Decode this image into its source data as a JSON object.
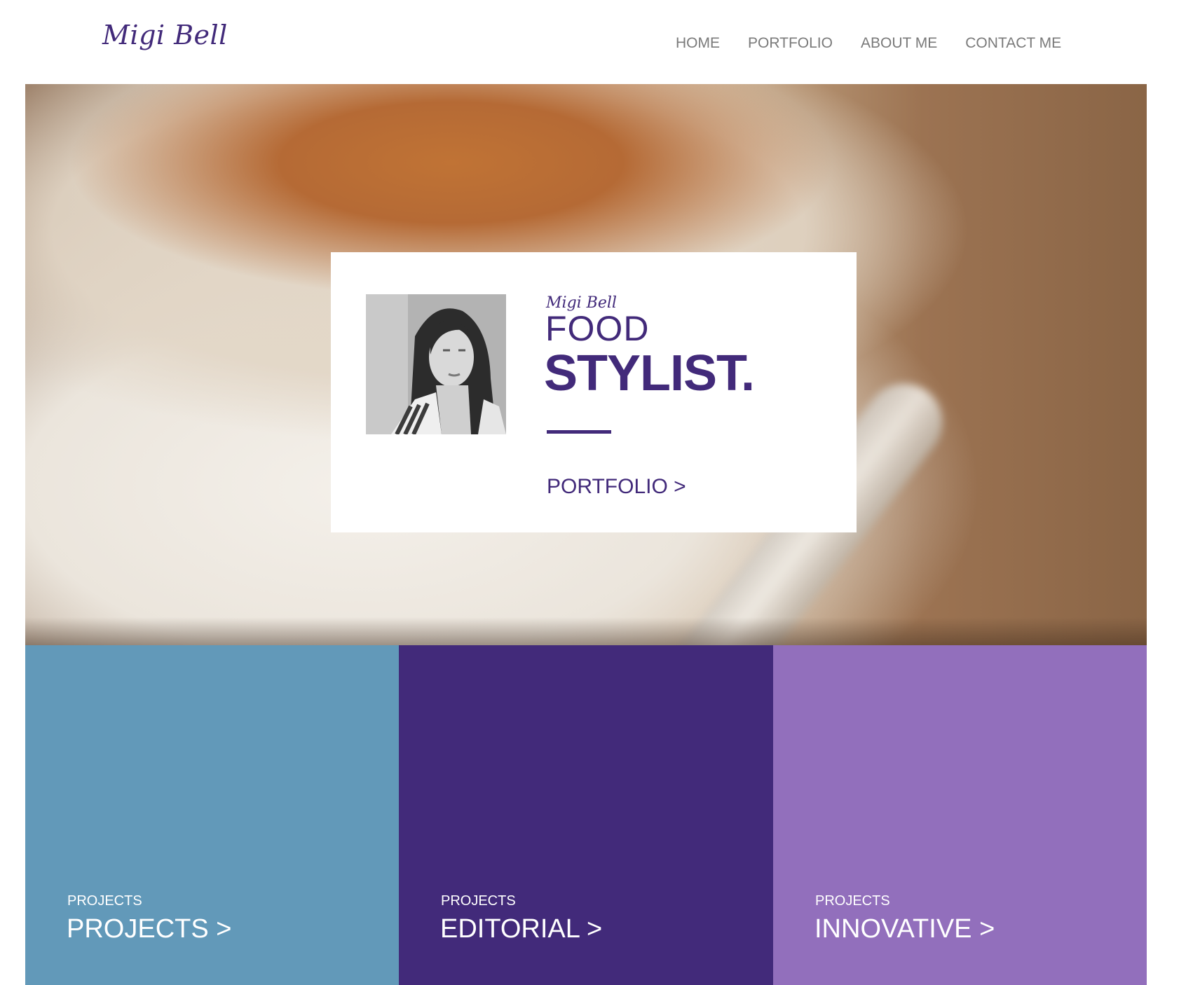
{
  "header": {
    "logo": "Migi Bell",
    "nav": [
      {
        "label": "HOME"
      },
      {
        "label": "PORTFOLIO"
      },
      {
        "label": "ABOUT ME"
      },
      {
        "label": "CONTACT ME"
      }
    ]
  },
  "hero": {
    "card": {
      "name": "Migi Bell",
      "title_line1": "FOOD",
      "title_line2": "STYLIST.",
      "link": "PORTFOLIO >"
    }
  },
  "tiles": [
    {
      "kicker": "PROJECTS",
      "link": "PROJECTS >",
      "color": "#6299b9"
    },
    {
      "kicker": "PROJECTS",
      "link": "EDITORIAL >",
      "color": "#422a7a"
    },
    {
      "kicker": "PROJECTS",
      "link": "INNOVATIVE >",
      "color": "#926fbc"
    }
  ],
  "colors": {
    "brand": "#422a7a",
    "nav_text": "#7a7a7a"
  }
}
